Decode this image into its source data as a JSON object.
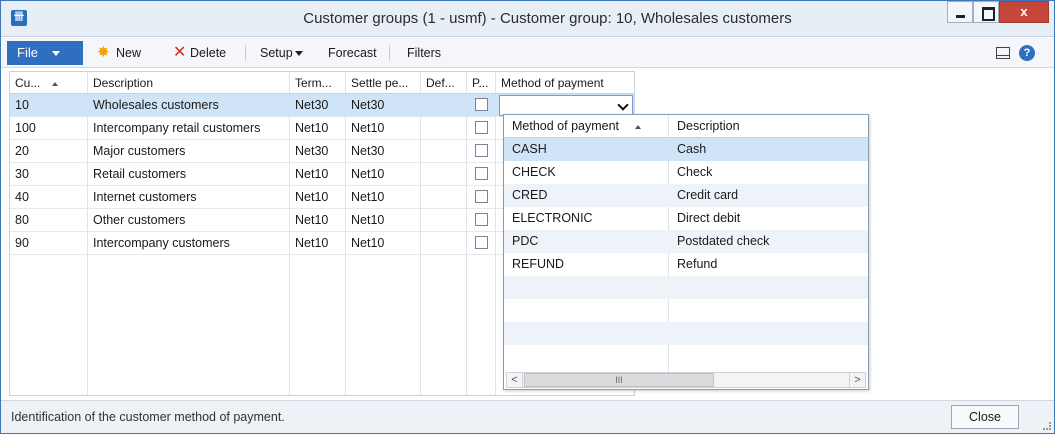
{
  "window": {
    "title": "Customer groups (1 - usmf) - Customer group: 10, Wholesales customers",
    "app_icon_glyph": "卌",
    "close_glyph": "x",
    "accent_color": "#2e6fbf"
  },
  "toolbar": {
    "file_label": "File",
    "new_label": "New",
    "delete_label": "Delete",
    "setup_label": "Setup",
    "forecast_label": "Forecast",
    "filters_label": "Filters",
    "help_glyph": "?"
  },
  "grid": {
    "headers": [
      "Cu...",
      "Description",
      "Term...",
      "Settle pe...",
      "Def...",
      "P...",
      "Method of payment"
    ],
    "rows": [
      {
        "group": "10",
        "description": "Wholesales customers",
        "terms": "Net30",
        "settle": "Net30",
        "selected": true
      },
      {
        "group": "100",
        "description": "Intercompany retail customers",
        "terms": "Net10",
        "settle": "Net10",
        "selected": false
      },
      {
        "group": "20",
        "description": "Major customers",
        "terms": "Net30",
        "settle": "Net30",
        "selected": false
      },
      {
        "group": "30",
        "description": "Retail customers",
        "terms": "Net10",
        "settle": "Net10",
        "selected": false
      },
      {
        "group": "40",
        "description": "Internet customers",
        "terms": "Net10",
        "settle": "Net10",
        "selected": false
      },
      {
        "group": "80",
        "description": "Other customers",
        "terms": "Net10",
        "settle": "Net10",
        "selected": false
      },
      {
        "group": "90",
        "description": "Intercompany  customers",
        "terms": "Net10",
        "settle": "Net10",
        "selected": false
      }
    ]
  },
  "lookup": {
    "headers": [
      "Method of payment",
      "Description"
    ],
    "rows": [
      {
        "code": "CASH",
        "description": "Cash",
        "selected": true
      },
      {
        "code": "CHECK",
        "description": "Check",
        "selected": false
      },
      {
        "code": "CRED",
        "description": "Credit card",
        "selected": false
      },
      {
        "code": "ELECTRONIC",
        "description": "Direct debit",
        "selected": false
      },
      {
        "code": "PDC",
        "description": "Postdated check",
        "selected": false
      },
      {
        "code": "REFUND",
        "description": "Refund",
        "selected": false
      }
    ],
    "scroll_left": "<",
    "scroll_right": ">",
    "scroll_thumb": "III"
  },
  "status": {
    "text": "Identification of the customer method of payment.",
    "close_label": "Close"
  }
}
